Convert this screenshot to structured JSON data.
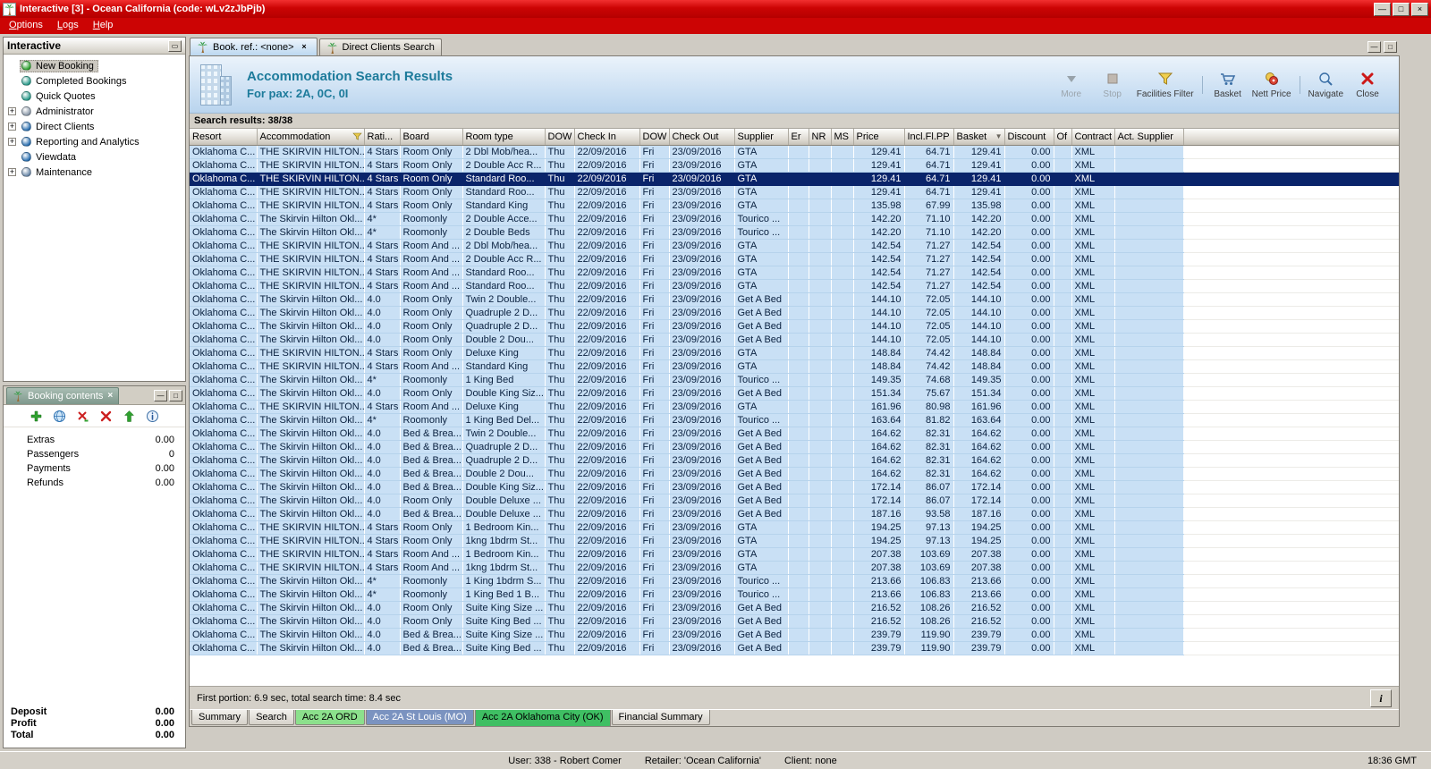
{
  "window": {
    "title": "Interactive [3] - Ocean California (code: wLv2zJbPjb)",
    "menu": [
      "Options",
      "Logs",
      "Help"
    ],
    "controls": {
      "minimize": "—",
      "maximize": "□",
      "close": "×"
    },
    "status": {
      "user": "User: 338 - Robert Comer",
      "retailer": "Retailer: 'Ocean California'",
      "client": "Client: none",
      "time": "18:36 GMT"
    }
  },
  "sidebar": {
    "title": "Interactive",
    "items": [
      {
        "label": "New Booking",
        "icon": "new-booking-icon",
        "selected": true,
        "expander": false
      },
      {
        "label": "Completed Bookings",
        "icon": "completed-bookings-icon",
        "expander": false
      },
      {
        "label": "Quick Quotes",
        "icon": "quick-quotes-icon",
        "expander": false
      },
      {
        "label": "Administrator",
        "icon": "administrator-icon",
        "expander": true
      },
      {
        "label": "Direct Clients",
        "icon": "direct-clients-icon",
        "expander": true
      },
      {
        "label": "Reporting and Analytics",
        "icon": "reporting-icon",
        "expander": true
      },
      {
        "label": "Viewdata",
        "icon": "viewdata-icon",
        "expander": false
      },
      {
        "label": "Maintenance",
        "icon": "maintenance-icon",
        "expander": true
      }
    ]
  },
  "booking_contents": {
    "title": "Booking contents",
    "toolbar": [
      "add-icon",
      "globe-icon",
      "remove-icon",
      "delete-icon",
      "up-icon",
      "info-icon"
    ],
    "rows": [
      {
        "label": "Extras",
        "value": "0.00"
      },
      {
        "label": "Passengers",
        "value": "0"
      },
      {
        "label": "Payments",
        "value": "0.00"
      },
      {
        "label": "Refunds",
        "value": "0.00"
      }
    ],
    "totals": [
      {
        "label": "Deposit",
        "value": "0.00"
      },
      {
        "label": "Profit",
        "value": "0.00"
      },
      {
        "label": "Total",
        "value": "0.00"
      }
    ]
  },
  "tabs": [
    {
      "label": "Book. ref.: <none>",
      "active": true,
      "closable": true
    },
    {
      "label": "Direct Clients Search",
      "active": false
    }
  ],
  "results": {
    "title": "Accommodation Search Results",
    "subtitle": "For pax: 2A, 0C, 0I",
    "summary": "Search results: 38/38",
    "footer": "First portion: 6.9 sec, total search time: 8.4 sec",
    "toolbar": [
      {
        "type": "button",
        "label": "More",
        "icon": "more-icon",
        "disabled": true
      },
      {
        "type": "button",
        "label": "Stop",
        "icon": "stop-icon",
        "disabled": true
      },
      {
        "type": "button",
        "label": "Facilities Filter",
        "icon": "facilities-filter-icon"
      },
      {
        "type": "separator"
      },
      {
        "type": "button",
        "label": "Basket",
        "icon": "basket-icon"
      },
      {
        "type": "button",
        "label": "Nett Price",
        "icon": "nett-price-icon"
      },
      {
        "type": "separator"
      },
      {
        "type": "button",
        "label": "Navigate",
        "icon": "navigate-icon"
      },
      {
        "type": "button",
        "label": "Close",
        "icon": "close-icon"
      }
    ],
    "columns": [
      {
        "label": "Resort"
      },
      {
        "label": "Accommodation",
        "icon": "filter"
      },
      {
        "label": "Rati..."
      },
      {
        "label": "Board"
      },
      {
        "label": "Room type"
      },
      {
        "label": "DOW"
      },
      {
        "label": "Check In"
      },
      {
        "label": "DOW"
      },
      {
        "label": "Check Out"
      },
      {
        "label": "Supplier"
      },
      {
        "label": "Er"
      },
      {
        "label": "NR"
      },
      {
        "label": "MS"
      },
      {
        "label": "Price"
      },
      {
        "label": "Incl.Fl.PP"
      },
      {
        "label": "Basket",
        "icon": "sort"
      },
      {
        "label": "Discount"
      },
      {
        "label": "Of"
      },
      {
        "label": "Contract"
      },
      {
        "label": "Act. Supplier"
      }
    ],
    "row_constants": {
      "resort": "Oklahoma C...",
      "dow_in": "Thu",
      "check_in": "22/09/2016",
      "dow_out": "Fri",
      "check_out": "23/09/2016",
      "discount": "0.00",
      "contract": "XML"
    },
    "selected_row": 2,
    "rows": [
      [
        "THE SKIRVIN HILTON...",
        "4 Stars",
        "Room Only",
        "2 Dbl Mob/hea...",
        "GTA",
        "129.41",
        "64.71"
      ],
      [
        "THE SKIRVIN HILTON...",
        "4 Stars",
        "Room Only",
        "2 Double Acc R...",
        "GTA",
        "129.41",
        "64.71"
      ],
      [
        "THE SKIRVIN HILTON...",
        "4 Stars",
        "Room Only",
        "Standard Roo...",
        "GTA",
        "129.41",
        "64.71"
      ],
      [
        "THE SKIRVIN HILTON...",
        "4 Stars",
        "Room Only",
        "Standard Roo...",
        "GTA",
        "129.41",
        "64.71"
      ],
      [
        "THE SKIRVIN HILTON...",
        "4 Stars",
        "Room Only",
        "Standard King",
        "GTA",
        "135.98",
        "67.99"
      ],
      [
        "The Skirvin Hilton Okl...",
        "4*",
        "Roomonly",
        "2 Double Acce...",
        "Tourico ...",
        "142.20",
        "71.10"
      ],
      [
        "The Skirvin Hilton Okl...",
        "4*",
        "Roomonly",
        "2 Double Beds",
        "Tourico ...",
        "142.20",
        "71.10"
      ],
      [
        "THE SKIRVIN HILTON...",
        "4 Stars",
        "Room And ...",
        "2 Dbl Mob/hea...",
        "GTA",
        "142.54",
        "71.27"
      ],
      [
        "THE SKIRVIN HILTON...",
        "4 Stars",
        "Room And ...",
        "2 Double Acc R...",
        "GTA",
        "142.54",
        "71.27"
      ],
      [
        "THE SKIRVIN HILTON...",
        "4 Stars",
        "Room And ...",
        "Standard Roo...",
        "GTA",
        "142.54",
        "71.27"
      ],
      [
        "THE SKIRVIN HILTON...",
        "4 Stars",
        "Room And ...",
        "Standard Roo...",
        "GTA",
        "142.54",
        "71.27"
      ],
      [
        "The Skirvin Hilton Okl...",
        "4.0",
        "Room Only",
        "Twin 2 Double...",
        "Get A Bed",
        "144.10",
        "72.05"
      ],
      [
        "The Skirvin Hilton Okl...",
        "4.0",
        "Room Only",
        "Quadruple 2 D...",
        "Get A Bed",
        "144.10",
        "72.05"
      ],
      [
        "The Skirvin Hilton Okl...",
        "4.0",
        "Room Only",
        "Quadruple 2 D...",
        "Get A Bed",
        "144.10",
        "72.05"
      ],
      [
        "The Skirvin Hilton Okl...",
        "4.0",
        "Room Only",
        "Double 2 Dou...",
        "Get A Bed",
        "144.10",
        "72.05"
      ],
      [
        "THE SKIRVIN HILTON...",
        "4 Stars",
        "Room Only",
        "Deluxe King",
        "GTA",
        "148.84",
        "74.42"
      ],
      [
        "THE SKIRVIN HILTON...",
        "4 Stars",
        "Room And ...",
        "Standard King",
        "GTA",
        "148.84",
        "74.42"
      ],
      [
        "The Skirvin Hilton Okl...",
        "4*",
        "Roomonly",
        "1 King Bed",
        "Tourico ...",
        "149.35",
        "74.68"
      ],
      [
        "The Skirvin Hilton Okl...",
        "4.0",
        "Room Only",
        "Double King Siz...",
        "Get A Bed",
        "151.34",
        "75.67"
      ],
      [
        "THE SKIRVIN HILTON...",
        "4 Stars",
        "Room And ...",
        "Deluxe King",
        "GTA",
        "161.96",
        "80.98"
      ],
      [
        "The Skirvin Hilton Okl...",
        "4*",
        "Roomonly",
        "1 King Bed Del...",
        "Tourico ...",
        "163.64",
        "81.82"
      ],
      [
        "The Skirvin Hilton Okl...",
        "4.0",
        "Bed & Brea...",
        "Twin 2 Double...",
        "Get A Bed",
        "164.62",
        "82.31"
      ],
      [
        "The Skirvin Hilton Okl...",
        "4.0",
        "Bed & Brea...",
        "Quadruple 2 D...",
        "Get A Bed",
        "164.62",
        "82.31"
      ],
      [
        "The Skirvin Hilton Okl...",
        "4.0",
        "Bed & Brea...",
        "Quadruple 2 D...",
        "Get A Bed",
        "164.62",
        "82.31"
      ],
      [
        "The Skirvin Hilton Okl...",
        "4.0",
        "Bed & Brea...",
        "Double 2 Dou...",
        "Get A Bed",
        "164.62",
        "82.31"
      ],
      [
        "The Skirvin Hilton Okl...",
        "4.0",
        "Bed & Brea...",
        "Double King Siz...",
        "Get A Bed",
        "172.14",
        "86.07"
      ],
      [
        "The Skirvin Hilton Okl...",
        "4.0",
        "Room Only",
        "Double Deluxe ...",
        "Get A Bed",
        "172.14",
        "86.07"
      ],
      [
        "The Skirvin Hilton Okl...",
        "4.0",
        "Bed & Brea...",
        "Double Deluxe ...",
        "Get A Bed",
        "187.16",
        "93.58"
      ],
      [
        "THE SKIRVIN HILTON...",
        "4 Stars",
        "Room Only",
        "1 Bedroom Kin...",
        "GTA",
        "194.25",
        "97.13"
      ],
      [
        "THE SKIRVIN HILTON...",
        "4 Stars",
        "Room Only",
        "1kng 1bdrm St...",
        "GTA",
        "194.25",
        "97.13"
      ],
      [
        "THE SKIRVIN HILTON...",
        "4 Stars",
        "Room And ...",
        "1 Bedroom Kin...",
        "GTA",
        "207.38",
        "103.69"
      ],
      [
        "THE SKIRVIN HILTON...",
        "4 Stars",
        "Room And ...",
        "1kng 1bdrm St...",
        "GTA",
        "207.38",
        "103.69"
      ],
      [
        "The Skirvin Hilton Okl...",
        "4*",
        "Roomonly",
        "1 King 1bdrm S...",
        "Tourico ...",
        "213.66",
        "106.83"
      ],
      [
        "The Skirvin Hilton Okl...",
        "4*",
        "Roomonly",
        "1 King Bed 1 B...",
        "Tourico ...",
        "213.66",
        "106.83"
      ],
      [
        "The Skirvin Hilton Okl...",
        "4.0",
        "Room Only",
        "Suite King Size ...",
        "Get A Bed",
        "216.52",
        "108.26"
      ],
      [
        "The Skirvin Hilton Okl...",
        "4.0",
        "Room Only",
        "Suite King Bed ...",
        "Get A Bed",
        "216.52",
        "108.26"
      ],
      [
        "The Skirvin Hilton Okl...",
        "4.0",
        "Bed & Brea...",
        "Suite King Size ...",
        "Get A Bed",
        "239.79",
        "119.90"
      ],
      [
        "The Skirvin Hilton Okl...",
        "4.0",
        "Bed & Brea...",
        "Suite King Bed ...",
        "Get A Bed",
        "239.79",
        "119.90"
      ]
    ]
  },
  "bottom_tabs": [
    {
      "label": "Summary"
    },
    {
      "label": "Search"
    },
    {
      "label": "Acc 2A ORD",
      "bg": "#8ce08c"
    },
    {
      "label": "Acc 2A St Louis (MO)",
      "bg": "#7b93c0",
      "fg": "#ffffff"
    },
    {
      "label": "Acc 2A Oklahoma City (OK)",
      "bg": "#3fbf63",
      "active": true
    },
    {
      "label": "Financial Summary"
    }
  ]
}
